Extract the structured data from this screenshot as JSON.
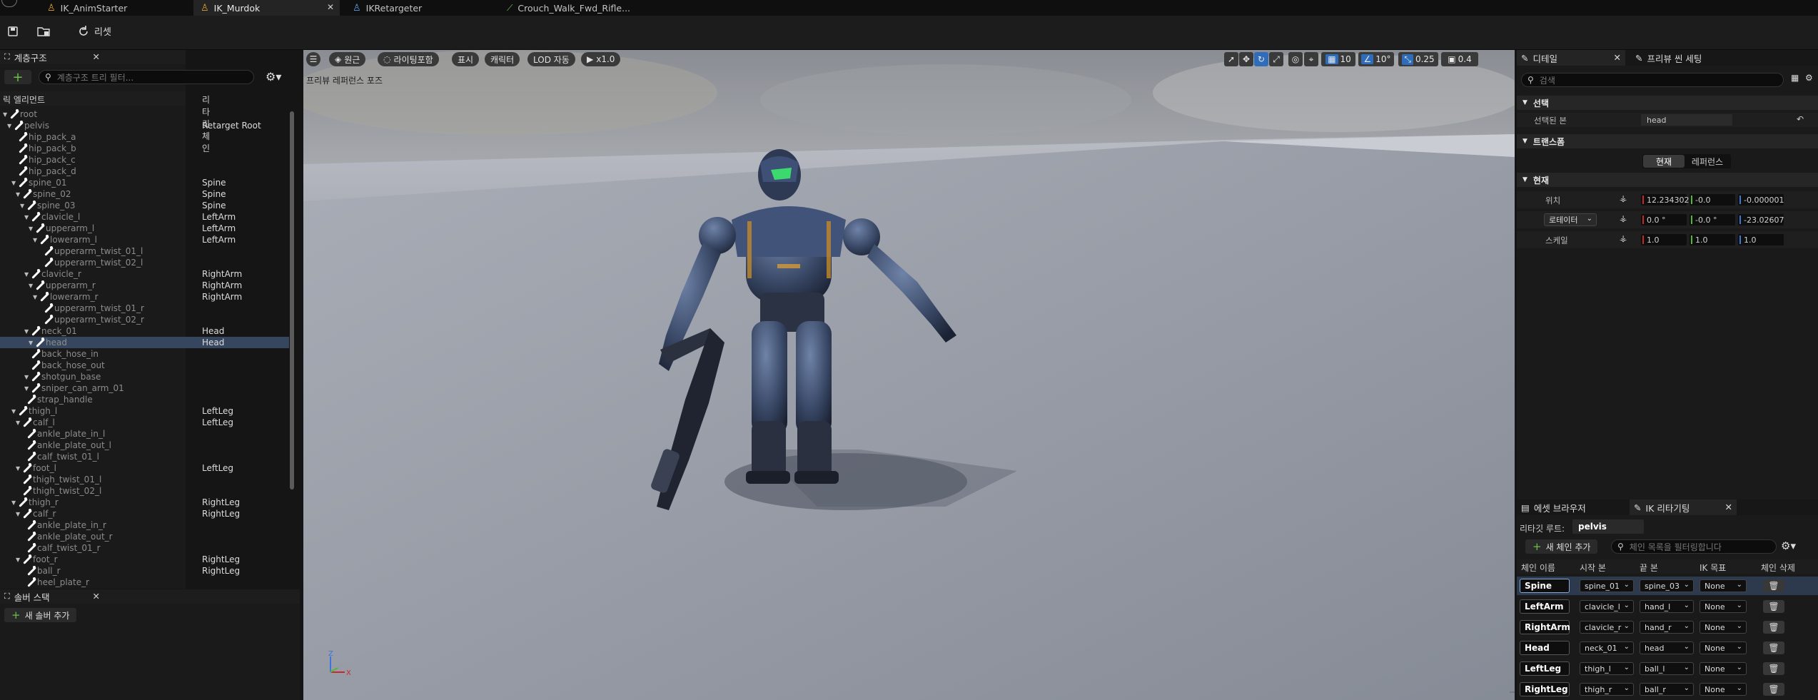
{
  "tabs": [
    {
      "label": "IK_AnimStarter"
    },
    {
      "label": "IK_Murdok"
    },
    {
      "label": "IKRetargeter"
    },
    {
      "label": "Crouch_Walk_Fwd_Rifle..."
    }
  ],
  "toolbar": {
    "reset_label": "리셋"
  },
  "hierarchy": {
    "title": "계층구조",
    "search_placeholder": "계층구조 트리 필터...",
    "col_element": "릭 엘리먼트",
    "col_chain": "리타깃 체인",
    "rows": [
      {
        "name": "root",
        "chain": ""
      },
      {
        "name": "pelvis",
        "chain": "Retarget Root"
      },
      {
        "name": "hip_pack_a",
        "chain": ""
      },
      {
        "name": "hip_pack_b",
        "chain": ""
      },
      {
        "name": "hip_pack_c",
        "chain": ""
      },
      {
        "name": "hip_pack_d",
        "chain": ""
      },
      {
        "name": "spine_01",
        "chain": "Spine"
      },
      {
        "name": "spine_02",
        "chain": "Spine"
      },
      {
        "name": "spine_03",
        "chain": "Spine"
      },
      {
        "name": "clavicle_l",
        "chain": "LeftArm"
      },
      {
        "name": "upperarm_l",
        "chain": "LeftArm"
      },
      {
        "name": "lowerarm_l",
        "chain": "LeftArm"
      },
      {
        "name": "upperarm_twist_01_l",
        "chain": ""
      },
      {
        "name": "upperarm_twist_02_l",
        "chain": ""
      },
      {
        "name": "clavicle_r",
        "chain": "RightArm"
      },
      {
        "name": "upperarm_r",
        "chain": "RightArm"
      },
      {
        "name": "lowerarm_r",
        "chain": "RightArm"
      },
      {
        "name": "upperarm_twist_01_r",
        "chain": ""
      },
      {
        "name": "upperarm_twist_02_r",
        "chain": ""
      },
      {
        "name": "neck_01",
        "chain": "Head"
      },
      {
        "name": "head",
        "chain": "Head"
      },
      {
        "name": "back_hose_in",
        "chain": ""
      },
      {
        "name": "back_hose_out",
        "chain": ""
      },
      {
        "name": "shotgun_base",
        "chain": ""
      },
      {
        "name": "sniper_can_arm_01",
        "chain": ""
      },
      {
        "name": "strap_handle",
        "chain": ""
      },
      {
        "name": "thigh_l",
        "chain": "LeftLeg"
      },
      {
        "name": "calf_l",
        "chain": "LeftLeg"
      },
      {
        "name": "ankle_plate_in_l",
        "chain": ""
      },
      {
        "name": "ankle_plate_out_l",
        "chain": ""
      },
      {
        "name": "calf_twist_01_l",
        "chain": ""
      },
      {
        "name": "foot_l",
        "chain": "LeftLeg"
      },
      {
        "name": "thigh_twist_01_l",
        "chain": ""
      },
      {
        "name": "thigh_twist_02_l",
        "chain": ""
      },
      {
        "name": "thigh_r",
        "chain": "RightLeg"
      },
      {
        "name": "calf_r",
        "chain": "RightLeg"
      },
      {
        "name": "ankle_plate_in_r",
        "chain": ""
      },
      {
        "name": "ankle_plate_out_r",
        "chain": ""
      },
      {
        "name": "calf_twist_01_r",
        "chain": ""
      },
      {
        "name": "foot_r",
        "chain": "RightLeg"
      },
      {
        "name": "ball_r",
        "chain": "RightLeg"
      },
      {
        "name": "heel_plate_r",
        "chain": ""
      }
    ]
  },
  "solver": {
    "title": "솔버 스택",
    "add_label": "새 솔버 추가"
  },
  "viewport": {
    "perspective": "원근",
    "lighting": "라이팅포함",
    "show": "표시",
    "character": "캐릭터",
    "lod": "LOD 자동",
    "speed": "x1.0",
    "grid_snap": "10",
    "angle_snap": "10°",
    "scale_snap": "0.25",
    "camera_speed": "0.4",
    "mode_text": "프리뷰 레퍼런스 포즈"
  },
  "details": {
    "tab_details": "디테일",
    "tab_preview": "프리뷰 씬 세팅",
    "search_placeholder": "검색",
    "section_selection": "선택",
    "selected_bone_label": "선택된 본",
    "selected_bone_value": "head",
    "section_transform": "트랜스폼",
    "toggle_current": "현재",
    "toggle_reference": "레퍼런스",
    "section_current": "현재",
    "location_label": "위치",
    "location": [
      "12.234302",
      "-0.0",
      "-0.000001"
    ],
    "rotation_label": "로테이터",
    "rotation": [
      "0.0 °",
      "-0.0 °",
      "-23.02607"
    ],
    "scale_label": "스케일",
    "scale": [
      "1.0",
      "1.0",
      "1.0"
    ]
  },
  "ik": {
    "tab_asset": "에셋 브라우저",
    "tab_ik": "IK 리타기팅",
    "root_label": "리타깃 루트:",
    "root_value": "pelvis",
    "add_chain": "새 체인 추가",
    "filter_placeholder": "체인 목록을 필터링합니다",
    "columns": [
      "체인 이름",
      "시작 본",
      "끝 본",
      "IK 목표",
      "체인 삭제"
    ],
    "chains": [
      {
        "name": "Spine",
        "start": "spine_01",
        "end": "spine_03",
        "goal": "None"
      },
      {
        "name": "LeftArm",
        "start": "clavicle_l",
        "end": "hand_l",
        "goal": "None"
      },
      {
        "name": "RightArm",
        "start": "clavicle_r",
        "end": "hand_r",
        "goal": "None"
      },
      {
        "name": "Head",
        "start": "neck_01",
        "end": "head",
        "goal": "None"
      },
      {
        "name": "LeftLeg",
        "start": "thigh_l",
        "end": "ball_l",
        "goal": "None"
      },
      {
        "name": "RightLeg",
        "start": "thigh_r",
        "end": "ball_r",
        "goal": "None"
      }
    ]
  }
}
